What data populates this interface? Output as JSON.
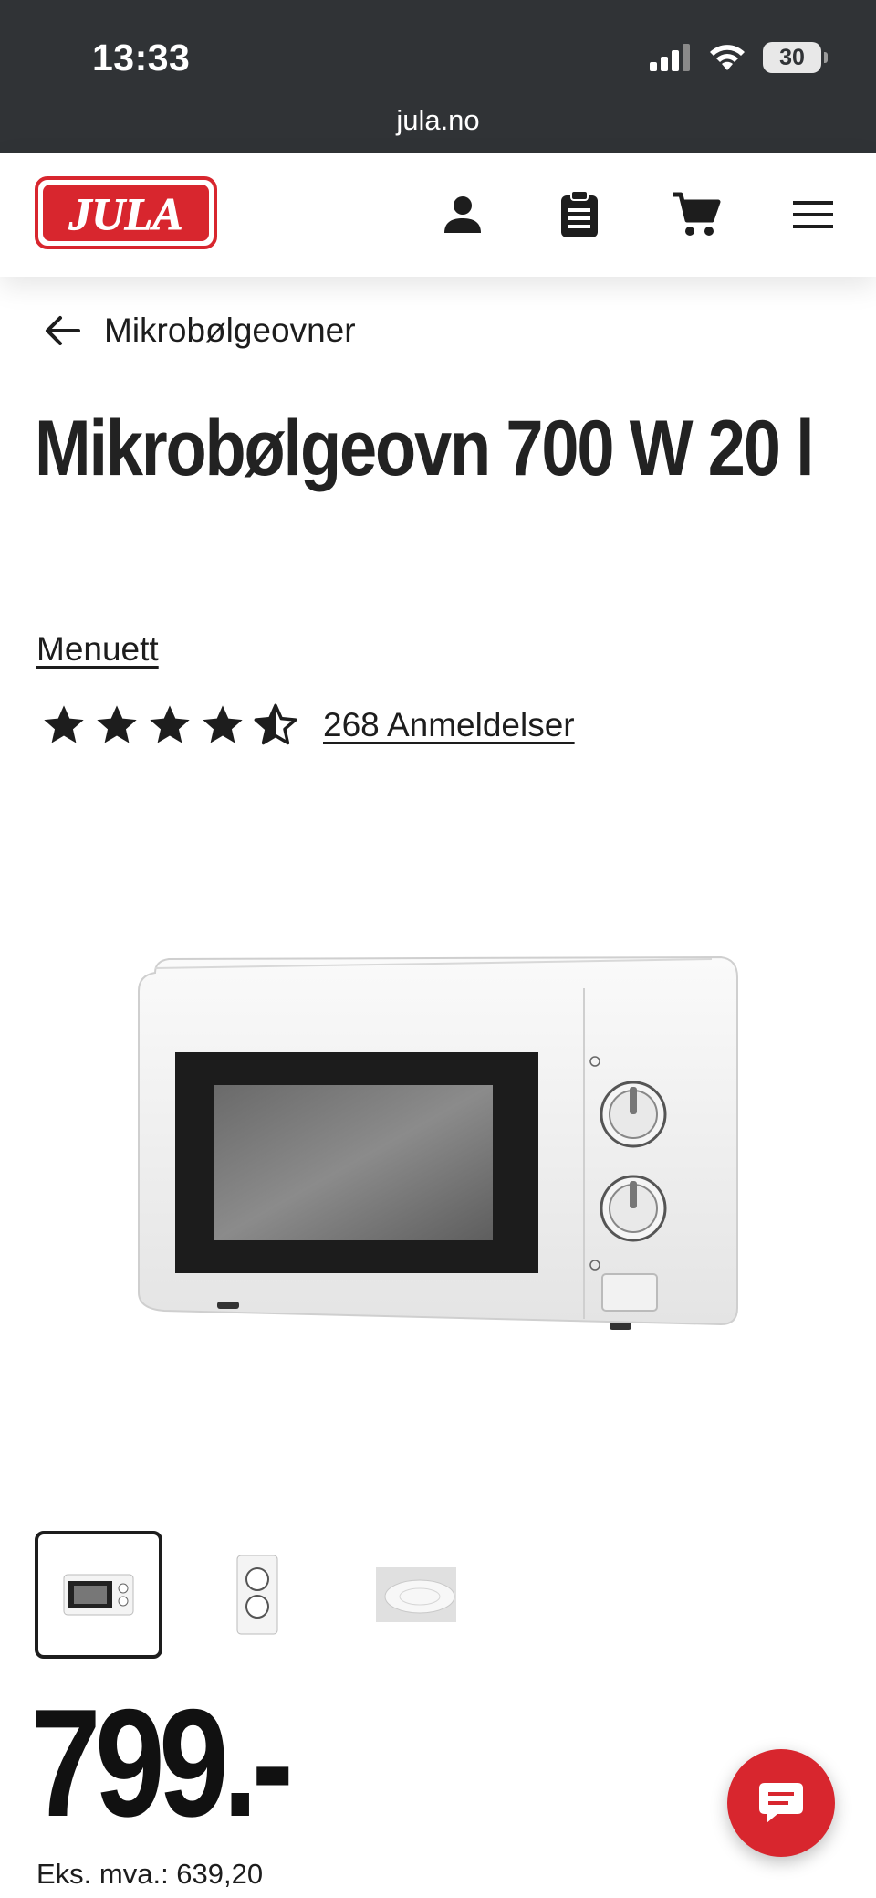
{
  "status_bar": {
    "time": "13:33",
    "battery": "30"
  },
  "browser": {
    "url": "jula.no"
  },
  "header": {
    "logo_text": "JULA"
  },
  "breadcrumb": {
    "label": "Mikrobølgeovner"
  },
  "product": {
    "title": "Mikrobølgeovn 700 W 20 l",
    "brand": "Menuett",
    "rating": 4.5,
    "reviews_label": "268 Anmeldelser",
    "price": "799.-",
    "vat_label": "Eks. mva.: 639,20"
  },
  "thumbnails": {
    "count": 3,
    "active_index": 0
  },
  "colors": {
    "brand_red": "#d8262e",
    "status_bar": "#303336",
    "text": "#1d1d1d"
  }
}
